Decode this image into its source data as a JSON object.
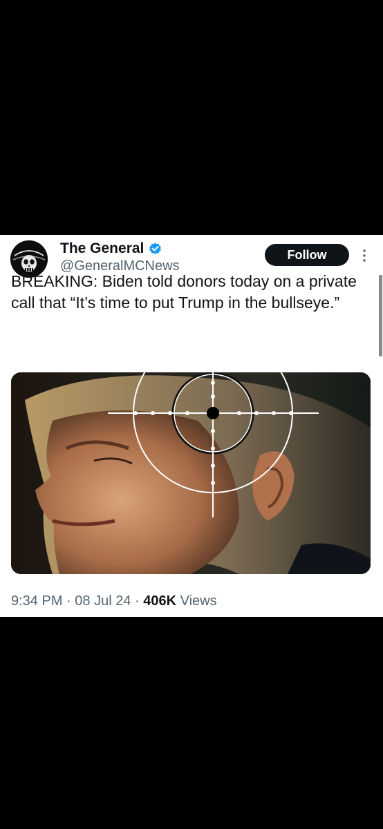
{
  "header": {
    "display_name": "The General",
    "handle": "@GeneralMCNews",
    "follow_label": "Follow"
  },
  "tweet": {
    "text": "BREAKING: Biden told donors today on a private call that “It’s time to put Trump in the bullseye.”",
    "time": "9:34 PM",
    "separator": "·",
    "date": "08 Jul 24",
    "views_count": "406K",
    "views_label": "Views"
  },
  "colors": {
    "verified": "#1d9bf0",
    "follow_bg": "#0f1419",
    "secondary_text": "#536471"
  },
  "icons": [
    "verified-badge-icon",
    "more-options-icon"
  ]
}
